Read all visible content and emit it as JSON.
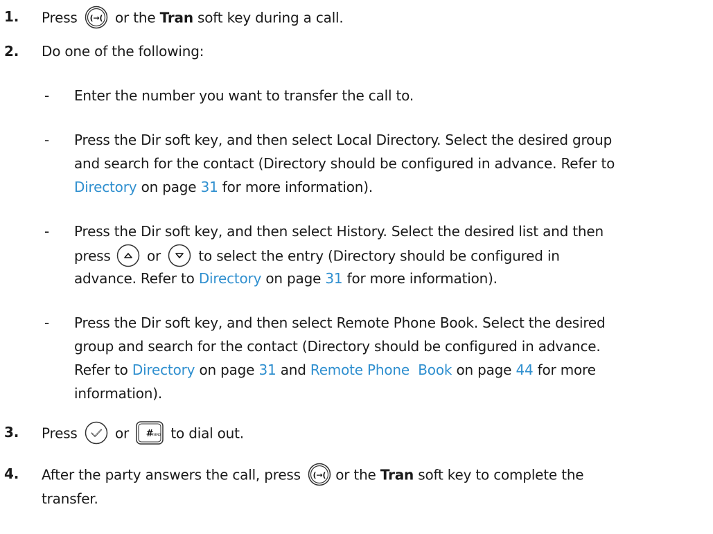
{
  "steps": [
    {
      "num": "1.",
      "a": "Press",
      "b": "or the",
      "soft_key": "Tran",
      "c": "soft key during a call."
    },
    {
      "num": "2.",
      "text": "Do one of the following:"
    },
    {
      "num": "3.",
      "a": "Press",
      "b": "or",
      "c": "to dial out."
    },
    {
      "num": "4.",
      "a": "After the party answers the call, press",
      "b": "or the",
      "soft_key": "Tran",
      "c": "soft key to complete the",
      "d": "transfer."
    }
  ],
  "options": [
    {
      "dash": "-",
      "text": "Enter the number you want to transfer the call to."
    },
    {
      "dash": "-",
      "l1": "Press the Dir soft key, and then select Local Directory. Select the desired group",
      "l2": "and search for the contact (Directory should be configured in advance. Refer to",
      "link": "Directory",
      "mid": "on page",
      "page": "31",
      "end": "for more information)."
    },
    {
      "dash": "-",
      "l1": "Press the Dir soft key, and then select History. Select the desired list and then",
      "l2a": "press",
      "l2b": "or",
      "l2c": "to select the entry (Directory should be configured in",
      "l3a": "advance. Refer to",
      "link": "Directory",
      "mid": "on page",
      "page": "31",
      "end": "for more information)."
    },
    {
      "dash": "-",
      "l1": "Press the Dir soft key, and then select Remote Phone Book. Select the desired",
      "l2": "group and search for the contact (Directory should be configured in advance.",
      "l3a": "Refer to",
      "link1": "Directory",
      "mid1": "on page",
      "page1": "31",
      "and": "and",
      "link2": "Remote Phone  Book",
      "mid2": "on page",
      "page2": "44",
      "end": "for more",
      "l4": "information)."
    }
  ],
  "icons": {
    "transfer_key": "transfer-key-icon",
    "up_key": "up-arrow-key-icon",
    "down_key": "down-arrow-key-icon",
    "ok_key": "ok-checkmark-key-icon",
    "send_key": "hash-send-key-icon",
    "send_key_label": "#SEND"
  },
  "colors": {
    "link": "#2f8fcf",
    "text": "#1a1a1a"
  }
}
